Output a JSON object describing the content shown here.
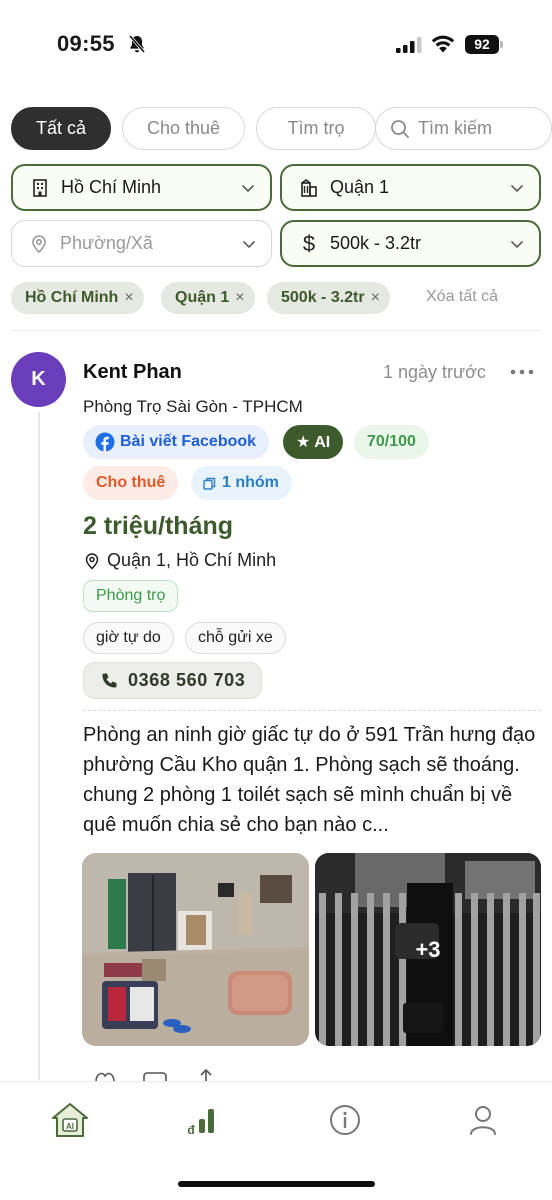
{
  "status_bar": {
    "time": "09:55",
    "battery": "92"
  },
  "tabs": [
    {
      "label": "Tất cả",
      "active": true
    },
    {
      "label": "Cho thuê",
      "active": false
    },
    {
      "label": "Tìm trọ",
      "active": false
    },
    {
      "label": "Tìm kiếm",
      "active": false
    }
  ],
  "filters": {
    "city": "Hồ Chí Minh",
    "district": "Quận 1",
    "ward_placeholder": "Phường/Xã",
    "price": "500k - 3.2tr"
  },
  "active_chips": [
    "Hồ Chí Minh",
    "Quận 1",
    "500k - 3.2tr"
  ],
  "chip_remove": "×",
  "clear_all": "Xóa tất cả",
  "post": {
    "avatar_letter": "K",
    "author": "Kent Phan",
    "time": "1 ngày trước",
    "group_name": "Phòng Trọ Sài Gòn - TPHCM",
    "source_badge": "Bài viết Facebook",
    "ai_badge": "★ AI",
    "score": "70/100",
    "type_badge": "Cho thuê",
    "group_count": "1 nhóm",
    "price": "2 triệu/tháng",
    "location": "Quận 1, Hồ Chí Minh",
    "room_type": "Phòng trọ",
    "features": [
      "giờ tự do",
      "chỗ gửi xe"
    ],
    "phone": "0368 560 703",
    "content": "Phòng an ninh giờ giấc tự do ở 591 Trần hưng đạo phường Cầu Kho quận 1. Phòng sạch sẽ thoáng. chung 2 phòng 1 toilét sạch sẽ mình chuẩn bị về quê muốn chia sẻ cho bạn nào c...",
    "more_photos": "+3"
  },
  "nav_icons": [
    "home-ai-icon",
    "stats-icon",
    "info-icon",
    "profile-icon"
  ],
  "colors": {
    "accent_green": "#3d5a2c",
    "avatar": "#6b3dbb",
    "facebook_blue": "#1f5fd6",
    "rent_orange": "#e05a28"
  }
}
